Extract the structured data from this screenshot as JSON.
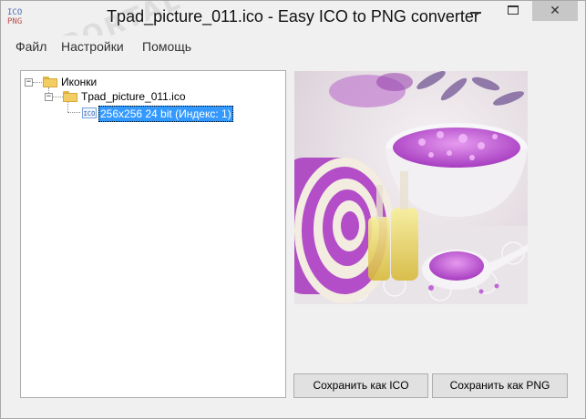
{
  "window": {
    "title": "Tpad_picture_011.ico - Easy ICO to PNG converter",
    "app_icon_top": "ICO",
    "app_icon_bottom": "PNG",
    "close_glyph": "✕"
  },
  "menu": {
    "items": [
      {
        "label": "Файл"
      },
      {
        "label": "Настройки"
      },
      {
        "label": "Помощь"
      }
    ]
  },
  "tree": {
    "root": {
      "label": "Иконки",
      "expander": "−"
    },
    "file": {
      "label": "Tpad_picture_011.ico",
      "expander": "−"
    },
    "image": {
      "label": "256x256 24 bit (Индекс: 1)",
      "badge": "ICO"
    }
  },
  "buttons": {
    "save_ico": "Сохранить как ICO",
    "save_png": "Сохранить как PNG"
  },
  "watermark": "PORTAL",
  "colors": {
    "selection": "#3399ff",
    "folder": "#f2cd63",
    "lavender": "#b052c8"
  }
}
